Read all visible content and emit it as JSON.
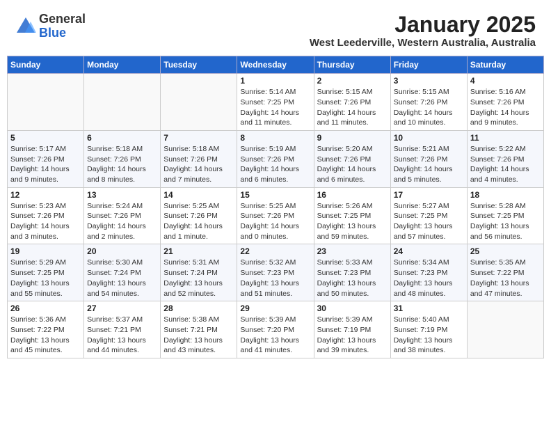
{
  "header": {
    "logo_general": "General",
    "logo_blue": "Blue",
    "month_title": "January 2025",
    "subtitle": "West Leederville, Western Australia, Australia"
  },
  "days_of_week": [
    "Sunday",
    "Monday",
    "Tuesday",
    "Wednesday",
    "Thursday",
    "Friday",
    "Saturday"
  ],
  "weeks": [
    [
      {
        "day": "",
        "info": ""
      },
      {
        "day": "",
        "info": ""
      },
      {
        "day": "",
        "info": ""
      },
      {
        "day": "1",
        "info": "Sunrise: 5:14 AM\nSunset: 7:25 PM\nDaylight: 14 hours and 11 minutes."
      },
      {
        "day": "2",
        "info": "Sunrise: 5:15 AM\nSunset: 7:26 PM\nDaylight: 14 hours and 11 minutes."
      },
      {
        "day": "3",
        "info": "Sunrise: 5:15 AM\nSunset: 7:26 PM\nDaylight: 14 hours and 10 minutes."
      },
      {
        "day": "4",
        "info": "Sunrise: 5:16 AM\nSunset: 7:26 PM\nDaylight: 14 hours and 9 minutes."
      }
    ],
    [
      {
        "day": "5",
        "info": "Sunrise: 5:17 AM\nSunset: 7:26 PM\nDaylight: 14 hours and 9 minutes."
      },
      {
        "day": "6",
        "info": "Sunrise: 5:18 AM\nSunset: 7:26 PM\nDaylight: 14 hours and 8 minutes."
      },
      {
        "day": "7",
        "info": "Sunrise: 5:18 AM\nSunset: 7:26 PM\nDaylight: 14 hours and 7 minutes."
      },
      {
        "day": "8",
        "info": "Sunrise: 5:19 AM\nSunset: 7:26 PM\nDaylight: 14 hours and 6 minutes."
      },
      {
        "day": "9",
        "info": "Sunrise: 5:20 AM\nSunset: 7:26 PM\nDaylight: 14 hours and 6 minutes."
      },
      {
        "day": "10",
        "info": "Sunrise: 5:21 AM\nSunset: 7:26 PM\nDaylight: 14 hours and 5 minutes."
      },
      {
        "day": "11",
        "info": "Sunrise: 5:22 AM\nSunset: 7:26 PM\nDaylight: 14 hours and 4 minutes."
      }
    ],
    [
      {
        "day": "12",
        "info": "Sunrise: 5:23 AM\nSunset: 7:26 PM\nDaylight: 14 hours and 3 minutes."
      },
      {
        "day": "13",
        "info": "Sunrise: 5:24 AM\nSunset: 7:26 PM\nDaylight: 14 hours and 2 minutes."
      },
      {
        "day": "14",
        "info": "Sunrise: 5:25 AM\nSunset: 7:26 PM\nDaylight: 14 hours and 1 minute."
      },
      {
        "day": "15",
        "info": "Sunrise: 5:25 AM\nSunset: 7:26 PM\nDaylight: 14 hours and 0 minutes."
      },
      {
        "day": "16",
        "info": "Sunrise: 5:26 AM\nSunset: 7:25 PM\nDaylight: 13 hours and 59 minutes."
      },
      {
        "day": "17",
        "info": "Sunrise: 5:27 AM\nSunset: 7:25 PM\nDaylight: 13 hours and 57 minutes."
      },
      {
        "day": "18",
        "info": "Sunrise: 5:28 AM\nSunset: 7:25 PM\nDaylight: 13 hours and 56 minutes."
      }
    ],
    [
      {
        "day": "19",
        "info": "Sunrise: 5:29 AM\nSunset: 7:25 PM\nDaylight: 13 hours and 55 minutes."
      },
      {
        "day": "20",
        "info": "Sunrise: 5:30 AM\nSunset: 7:24 PM\nDaylight: 13 hours and 54 minutes."
      },
      {
        "day": "21",
        "info": "Sunrise: 5:31 AM\nSunset: 7:24 PM\nDaylight: 13 hours and 52 minutes."
      },
      {
        "day": "22",
        "info": "Sunrise: 5:32 AM\nSunset: 7:23 PM\nDaylight: 13 hours and 51 minutes."
      },
      {
        "day": "23",
        "info": "Sunrise: 5:33 AM\nSunset: 7:23 PM\nDaylight: 13 hours and 50 minutes."
      },
      {
        "day": "24",
        "info": "Sunrise: 5:34 AM\nSunset: 7:23 PM\nDaylight: 13 hours and 48 minutes."
      },
      {
        "day": "25",
        "info": "Sunrise: 5:35 AM\nSunset: 7:22 PM\nDaylight: 13 hours and 47 minutes."
      }
    ],
    [
      {
        "day": "26",
        "info": "Sunrise: 5:36 AM\nSunset: 7:22 PM\nDaylight: 13 hours and 45 minutes."
      },
      {
        "day": "27",
        "info": "Sunrise: 5:37 AM\nSunset: 7:21 PM\nDaylight: 13 hours and 44 minutes."
      },
      {
        "day": "28",
        "info": "Sunrise: 5:38 AM\nSunset: 7:21 PM\nDaylight: 13 hours and 43 minutes."
      },
      {
        "day": "29",
        "info": "Sunrise: 5:39 AM\nSunset: 7:20 PM\nDaylight: 13 hours and 41 minutes."
      },
      {
        "day": "30",
        "info": "Sunrise: 5:39 AM\nSunset: 7:19 PM\nDaylight: 13 hours and 39 minutes."
      },
      {
        "day": "31",
        "info": "Sunrise: 5:40 AM\nSunset: 7:19 PM\nDaylight: 13 hours and 38 minutes."
      },
      {
        "day": "",
        "info": ""
      }
    ]
  ]
}
